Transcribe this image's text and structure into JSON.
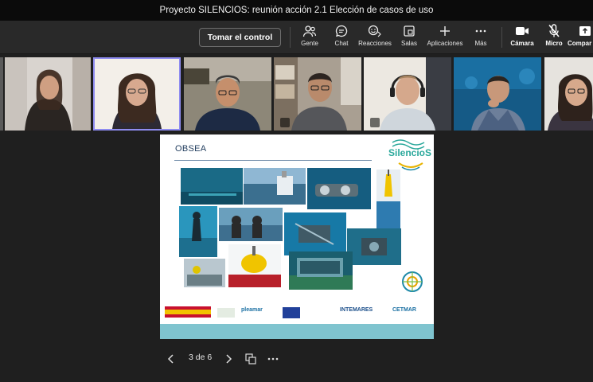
{
  "window": {
    "title": "Proyecto SILENCIOS: reunión acción 2.1 Elección de casos de uso"
  },
  "toolbar": {
    "take_control_label": "Tomar el control",
    "items": [
      {
        "label": "Gente",
        "icon": "people-icon"
      },
      {
        "label": "Chat",
        "icon": "chat-icon"
      },
      {
        "label": "Reacciones",
        "icon": "reactions-icon"
      },
      {
        "label": "Salas",
        "icon": "rooms-icon"
      },
      {
        "label": "Aplicaciones",
        "icon": "plus-icon"
      },
      {
        "label": "Más",
        "icon": "more-icon"
      },
      {
        "label": "Cámara",
        "icon": "camera-icon"
      },
      {
        "label": "Micro",
        "icon": "mic-off-icon"
      },
      {
        "label": "Compar",
        "icon": "share-icon"
      }
    ]
  },
  "participants": [
    {
      "id": "p1",
      "muted": false,
      "active": false
    },
    {
      "id": "p2",
      "muted": false,
      "active": true
    },
    {
      "id": "p3",
      "muted": false,
      "active": false
    },
    {
      "id": "p4",
      "muted": true,
      "active": false
    },
    {
      "id": "p5",
      "muted": true,
      "active": false
    },
    {
      "id": "p6",
      "muted": false,
      "active": false
    },
    {
      "id": "p7",
      "muted": false,
      "active": false
    }
  ],
  "slide": {
    "title": "OBSEA",
    "logo_text": "SilencioS",
    "partner_logos": [
      "pleamar",
      "INTEMARES",
      "CETMAR"
    ]
  },
  "pager": {
    "text": "3 de 6"
  },
  "colors": {
    "accent": "#8f8cf0",
    "toolbar": "#292929",
    "background": "#1f1f1f"
  }
}
